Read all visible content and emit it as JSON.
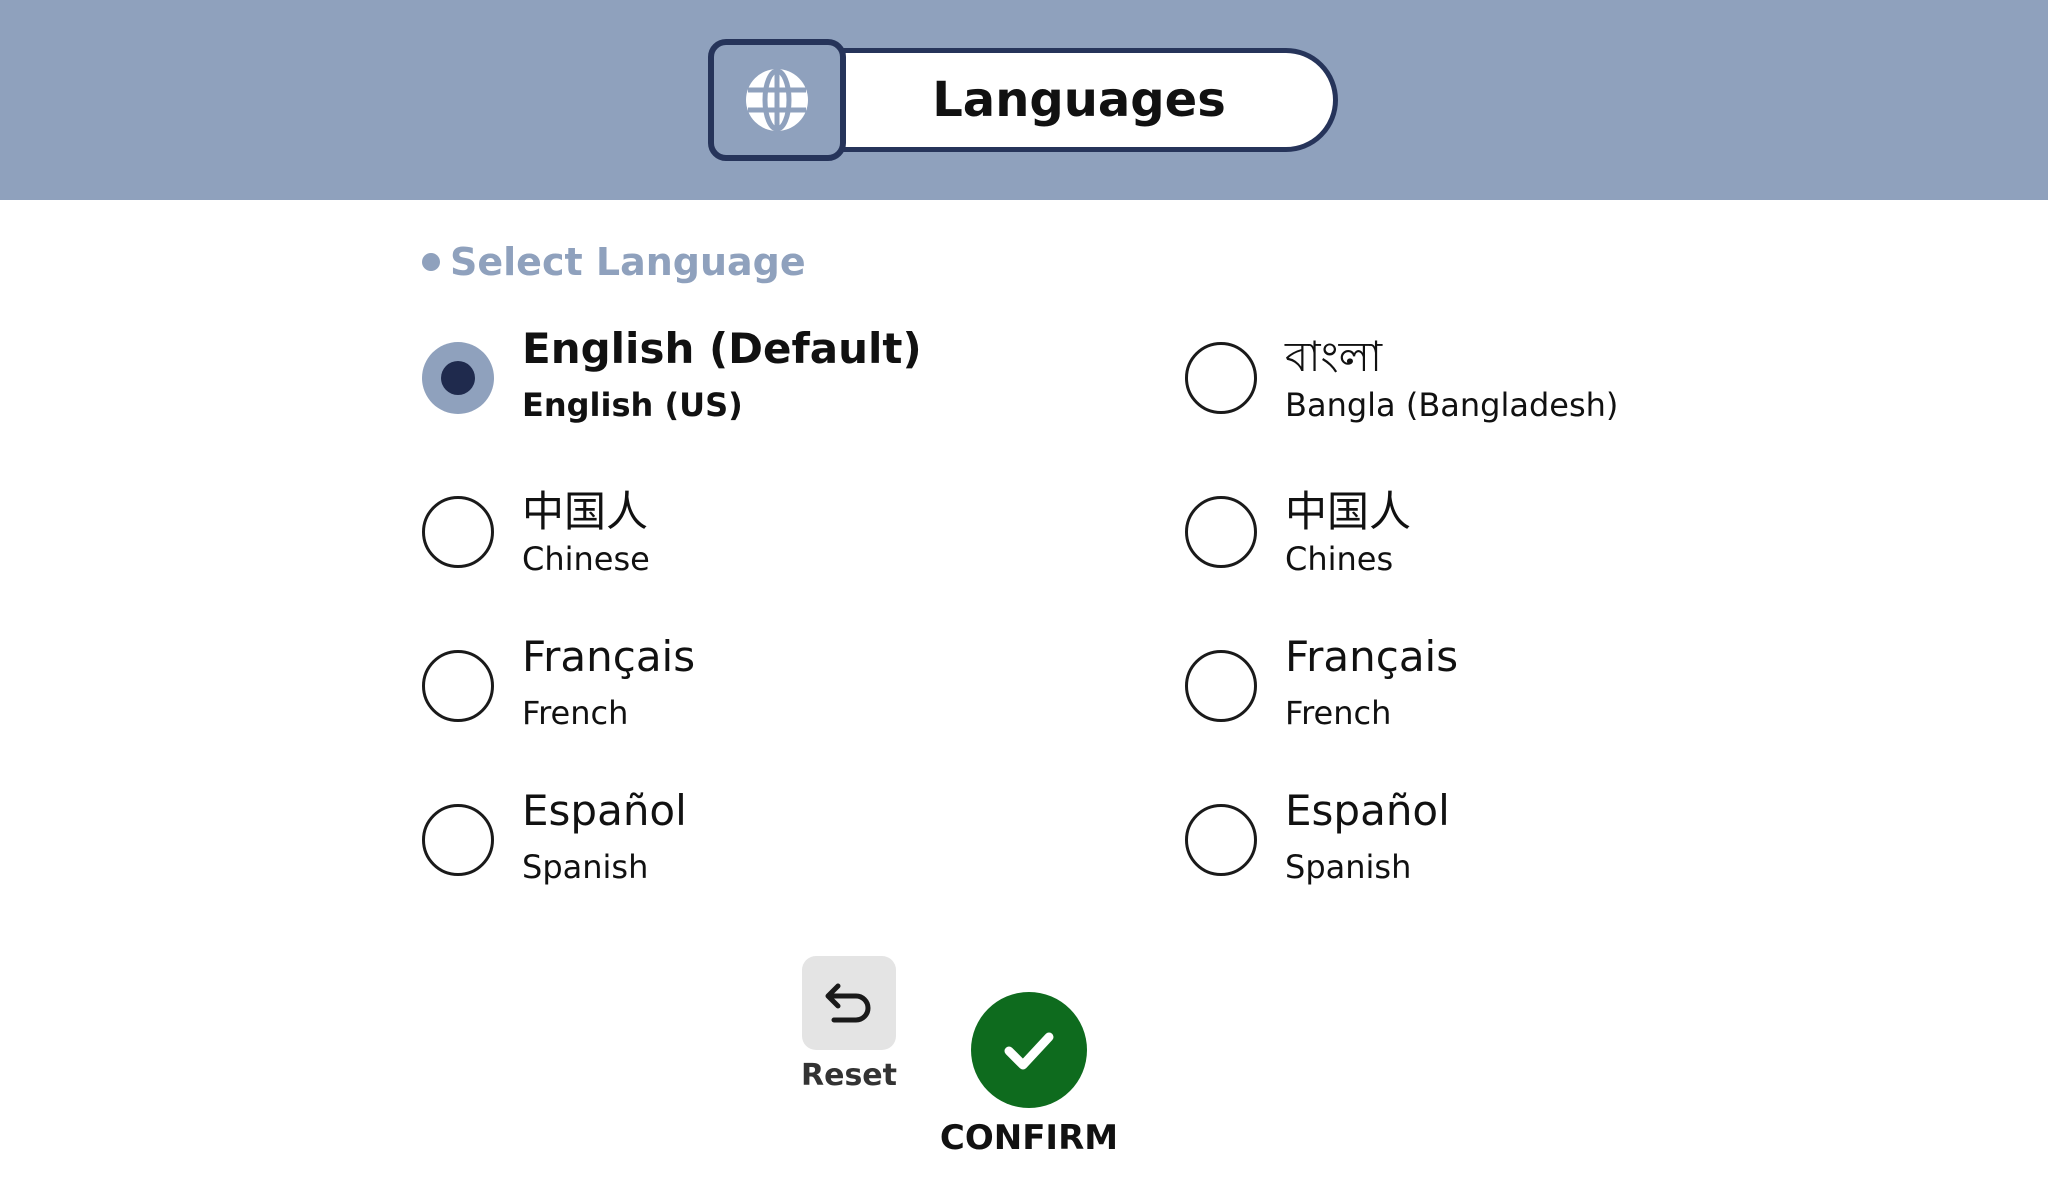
{
  "header": {
    "title": "Languages",
    "icon": "globe-icon",
    "background": "#8fa1bd",
    "accent": "#26345a"
  },
  "section": {
    "label": "Select Language"
  },
  "options": [
    {
      "native": "English (Default)",
      "sub": "English (US)",
      "selected": true
    },
    {
      "native": "বাংলা",
      "sub": "Bangla (Bangladesh)",
      "selected": false
    },
    {
      "native": "中国人",
      "sub": "Chinese",
      "selected": false
    },
    {
      "native": "中国人",
      "sub": "Chines",
      "selected": false
    },
    {
      "native": "Français",
      "sub": "French",
      "selected": false
    },
    {
      "native": "Français",
      "sub": "French",
      "selected": false
    },
    {
      "native": "Español",
      "sub": "Spanish",
      "selected": false
    },
    {
      "native": "Español",
      "sub": "Spanish",
      "selected": false
    }
  ],
  "actions": {
    "reset_label": "Reset",
    "reset_icon": "undo-icon",
    "confirm_label": "CONFIRM",
    "confirm_icon": "check-icon",
    "confirm_color": "#0e6b1e"
  }
}
